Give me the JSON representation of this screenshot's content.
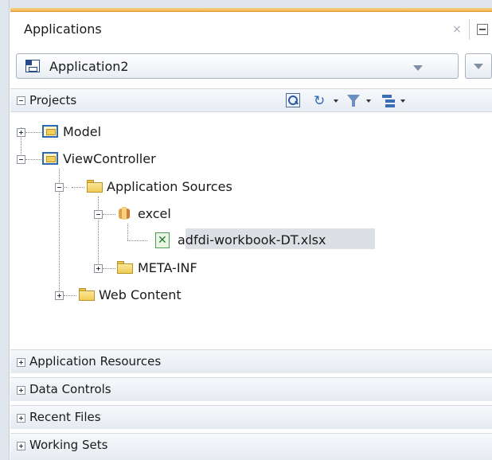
{
  "panel": {
    "title": "Applications",
    "close_glyph": "×"
  },
  "application_selector": {
    "selected": "Application2"
  },
  "projects": {
    "label": "Projects",
    "toolbar_icons": [
      "find-icon",
      "sync-icon",
      "filter-icon",
      "hierarchy-icon"
    ],
    "sync_glyph": "↻"
  },
  "tree": {
    "model": "Model",
    "viewcontroller": "ViewController",
    "application_sources": "Application Sources",
    "excel_package": "excel",
    "workbook_file": "adfdi-workbook-DT.xlsx",
    "meta_inf": "META-INF",
    "web_content": "Web Content"
  },
  "sections": [
    {
      "label": "Application Resources"
    },
    {
      "label": "Data Controls"
    },
    {
      "label": "Recent Files"
    },
    {
      "label": "Working Sets"
    }
  ],
  "colors": {
    "accent": "#f3b449",
    "selection": "#dcdfe3",
    "xlsx": "#1e7d2d"
  }
}
